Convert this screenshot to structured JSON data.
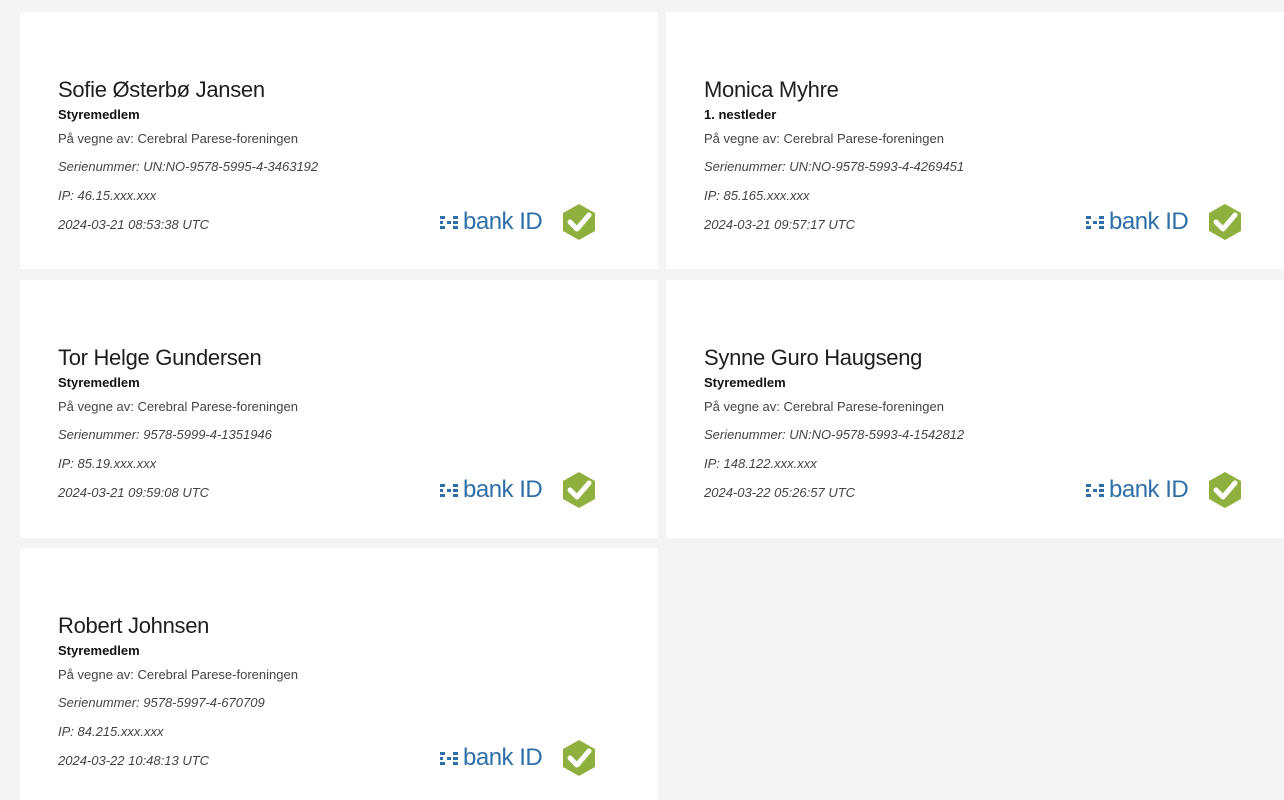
{
  "brand": {
    "bankid_label": "bank ID",
    "bankid_color": "#2f6fa8",
    "check_color": "#8fb03e"
  },
  "signers": [
    {
      "name": "Sofie Østerbø Jansen",
      "role": "Styremedlem",
      "on_behalf": "På vegne av: Cerebral Parese-foreningen",
      "serial": "Serienummer: UN:NO-9578-5995-4-3463192",
      "ip": "IP: 46.15.xxx.xxx",
      "timestamp": "2024-03-21 08:53:38 UTC",
      "icon": "check-shield-icon"
    },
    {
      "name": "Monica Myhre",
      "role": "1. nestleder",
      "on_behalf": "På vegne av: Cerebral Parese-foreningen",
      "serial": "Serienummer: UN:NO-9578-5993-4-4269451",
      "ip": "IP: 85.165.xxx.xxx",
      "timestamp": "2024-03-21 09:57:17 UTC",
      "icon": "check-shield-icon"
    },
    {
      "name": "Tor Helge Gundersen",
      "role": "Styremedlem",
      "on_behalf": "På vegne av: Cerebral Parese-foreningen",
      "serial": "Serienummer: 9578-5999-4-1351946",
      "ip": "IP: 85.19.xxx.xxx",
      "timestamp": "2024-03-21 09:59:08 UTC",
      "icon": "check-shield-icon"
    },
    {
      "name": "Synne Guro Haugseng",
      "role": "Styremedlem",
      "on_behalf": "På vegne av: Cerebral Parese-foreningen",
      "serial": "Serienummer: UN:NO-9578-5993-4-1542812",
      "ip": "IP: 148.122.xxx.xxx",
      "timestamp": "2024-03-22 05:26:57 UTC",
      "icon": "check-shield-icon"
    },
    {
      "name": "Robert Johnsen",
      "role": "Styremedlem",
      "on_behalf": "På vegne av: Cerebral Parese-foreningen",
      "serial": "Serienummer: 9578-5997-4-670709",
      "ip": "IP: 84.215.xxx.xxx",
      "timestamp": "2024-03-22 10:48:13 UTC",
      "icon": "check-shield-icon"
    }
  ]
}
